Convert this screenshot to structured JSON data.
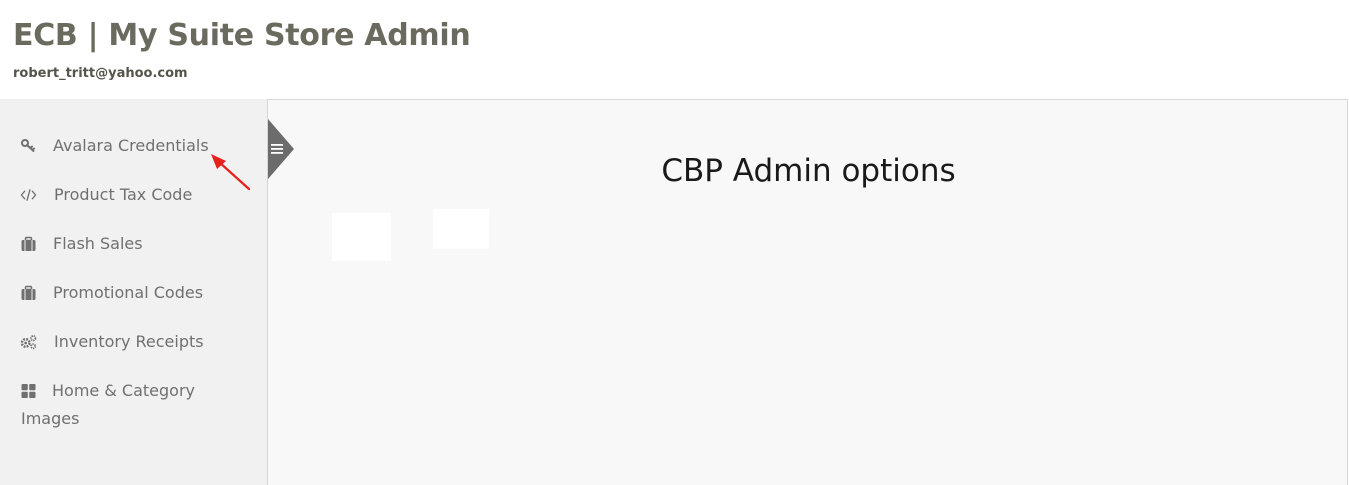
{
  "header": {
    "title": "ECB | My Suite Store Admin",
    "email": "robert_tritt@yahoo.com"
  },
  "sidebar": {
    "items": [
      {
        "label": "Avalara Credentials",
        "icon": "key-icon"
      },
      {
        "label": "Product Tax Code",
        "icon": "code-icon"
      },
      {
        "label": "Flash Sales",
        "icon": "briefcase-icon"
      },
      {
        "label": "Promotional Codes",
        "icon": "briefcase-icon"
      },
      {
        "label": "Inventory Receipts",
        "icon": "gears-icon"
      },
      {
        "label": "Home & Category Images",
        "icon": "grid-icon"
      }
    ]
  },
  "main": {
    "heading": "CBP Admin options"
  },
  "colors": {
    "title": "#6b6a5e",
    "sidebar_bg": "#f1f1f1",
    "main_bg": "#f8f8f8",
    "toggle": "#6c6c6c",
    "annotation_arrow": "#e8201c"
  }
}
